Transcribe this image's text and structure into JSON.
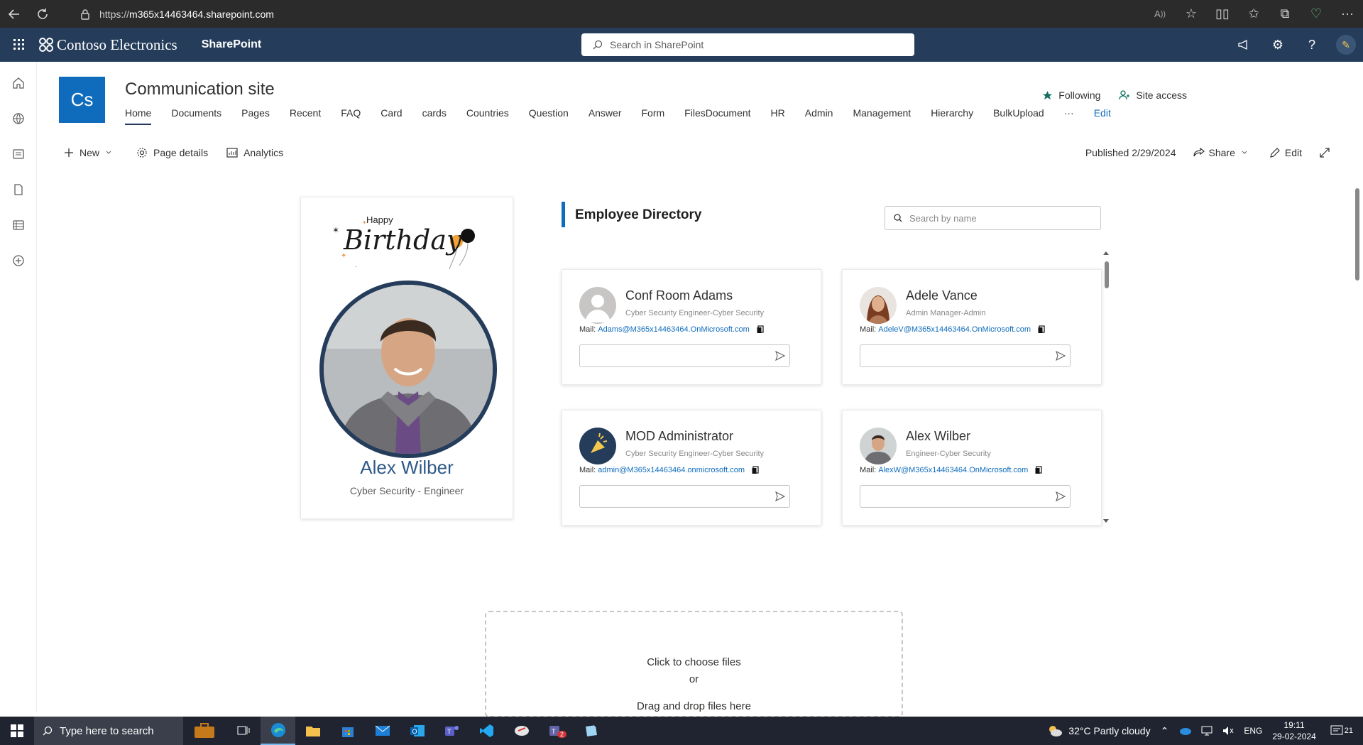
{
  "browser": {
    "url_prefix": "https://",
    "url_host": "m365x14463464.sharepoint.com"
  },
  "suite": {
    "brand": "Contoso Electronics",
    "app": "SharePoint",
    "search_placeholder": "Search in SharePoint"
  },
  "site": {
    "logo": "Cs",
    "title": "Communication site",
    "nav": [
      "Home",
      "Documents",
      "Pages",
      "Recent",
      "FAQ",
      "Card",
      "cards",
      "Countries",
      "Question",
      "Answer",
      "Form",
      "FilesDocument",
      "HR",
      "Admin",
      "Management",
      "Hierarchy",
      "BulkUpload",
      "···"
    ],
    "nav_edit": "Edit",
    "following": "Following",
    "site_access": "Site access"
  },
  "command": {
    "new": "New",
    "page_details": "Page details",
    "analytics": "Analytics",
    "published": "Published 2/29/2024",
    "share": "Share",
    "edit": "Edit"
  },
  "birthday": {
    "happy": "Happy",
    "birthday": "Birthday",
    "name": "Alex Wilber",
    "role": "Cyber Security - Engineer"
  },
  "directory": {
    "title": "Employee Directory",
    "search_placeholder": "Search by name",
    "mail_label": "Mail:",
    "employees": [
      {
        "name": "Conf Room Adams",
        "role": "Cyber Security Engineer-Cyber Security",
        "mail": "Adams@M365x14463464.OnMicrosoft.com"
      },
      {
        "name": "Adele Vance",
        "role": "Admin Manager-Admin",
        "mail": "AdeleV@M365x14463464.OnMicrosoft.com"
      },
      {
        "name": "MOD Administrator",
        "role": "Cyber Security Engineer-Cyber Security",
        "mail": "admin@M365x14463464.onmicrosoft.com"
      },
      {
        "name": "Alex Wilber",
        "role": "Engineer-Cyber Security",
        "mail": "AlexW@M365x14463464.OnMicrosoft.com"
      }
    ]
  },
  "upload": {
    "line1": "Click to choose files",
    "line2": "or",
    "line3": "Drag and drop files here"
  },
  "taskbar": {
    "search_placeholder": "Type here to search",
    "weather": "32°C  Partly cloudy",
    "lang": "ENG",
    "time": "19:11",
    "date": "29-02-2024",
    "notifications": "21",
    "teams_badge": "2"
  }
}
